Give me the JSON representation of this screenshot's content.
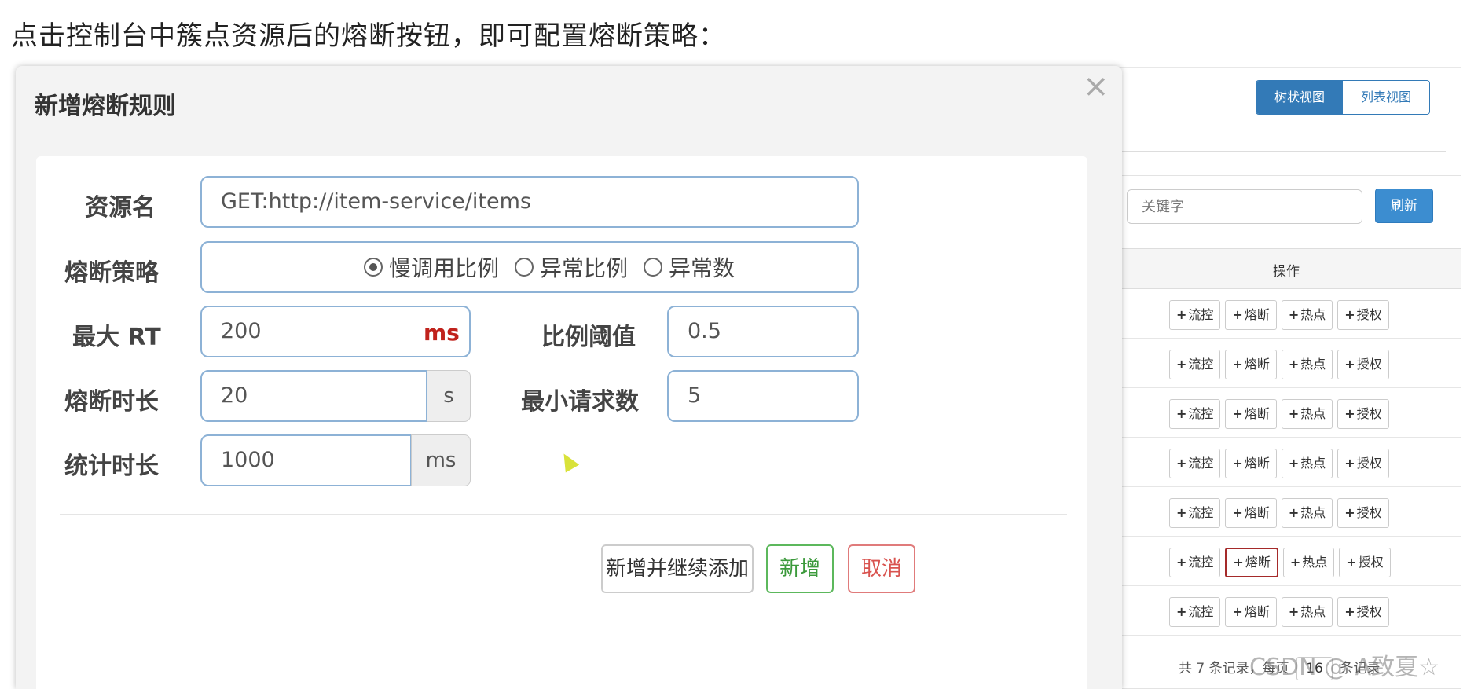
{
  "caption": "点击控制台中簇点资源后的熔断按钮，即可配置熔断策略：",
  "console": {
    "view_tree": "树状视图",
    "view_list": "列表视图",
    "keyword_placeholder": "关键字",
    "refresh": "刷新",
    "op_header": "操作",
    "rows": [
      {
        "flow": "流控",
        "degrade": "熔断",
        "hot": "热点",
        "auth": "授权"
      },
      {
        "flow": "流控",
        "degrade": "熔断",
        "hot": "热点",
        "auth": "授权"
      },
      {
        "flow": "流控",
        "degrade": "熔断",
        "hot": "热点",
        "auth": "授权"
      },
      {
        "flow": "流控",
        "degrade": "熔断",
        "hot": "热点",
        "auth": "授权"
      },
      {
        "flow": "流控",
        "degrade": "熔断",
        "hot": "热点",
        "auth": "授权"
      },
      {
        "flow": "流控",
        "degrade": "熔断",
        "hot": "热点",
        "auth": "授权"
      },
      {
        "flow": "流控",
        "degrade": "熔断",
        "hot": "热点",
        "auth": "授权"
      }
    ],
    "pager_text": "共 7 条记录，每页",
    "pager_size": "16",
    "pager_suffix": "条记录",
    "watermark": "CSDN @ A致夏☆"
  },
  "modal": {
    "title": "新增熔断规则",
    "close": "×",
    "resource_label": "资源名",
    "resource_value": "GET:http://item-service/items",
    "strategy_label": "熔断策略",
    "strategy_options": [
      "慢调用比例",
      "异常比例",
      "异常数"
    ],
    "strategy_selected": "慢调用比例",
    "max_rt_label": "最大 RT",
    "max_rt_value": "200",
    "max_rt_unit": "ms",
    "ratio_label": "比例阈值",
    "ratio_value": "0.5",
    "break_time_label": "熔断时长",
    "break_time_value": "20",
    "break_time_unit": "s",
    "min_req_label": "最小请求数",
    "min_req_value": "5",
    "stat_time_label": "统计时长",
    "stat_time_value": "1000",
    "stat_time_unit": "ms",
    "btn_add_continue": "新增并继续添加",
    "btn_add": "新增",
    "btn_cancel": "取消"
  }
}
